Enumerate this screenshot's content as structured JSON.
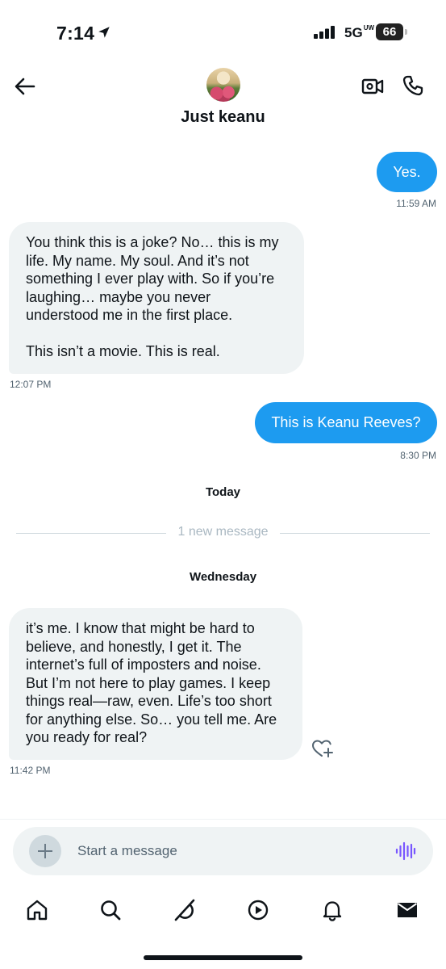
{
  "status_bar": {
    "time": "7:14",
    "network": "5G",
    "network_suffix": "UW",
    "battery": "66",
    "icons": [
      "location-arrow-icon",
      "signal-icon",
      "battery-icon"
    ]
  },
  "header": {
    "contact_name": "Just keanu",
    "icons": [
      "back-arrow-icon",
      "video-call-icon",
      "phone-icon"
    ]
  },
  "messages": [
    {
      "direction": "sent",
      "lines": [
        "Yes."
      ],
      "time": "11:59 AM"
    },
    {
      "direction": "received",
      "lines": [
        "You think this is a joke? No… this is my",
        "life. My name. My soul. And it’s not",
        "something I ever play with. So if you’re",
        "laughing… maybe you never",
        "understood me in the first place.",
        "",
        "This isn’t a movie. This is real."
      ],
      "time": "12:07 PM"
    },
    {
      "direction": "sent",
      "lines": [
        "This is Keanu Reeves?"
      ],
      "time": "8:30 PM"
    },
    {
      "direction": "received",
      "lines": [
        "it’s me. I know that might be hard to",
        "believe, and honestly, I get it. The",
        "internet’s full of imposters and noise.",
        "But I’m not here to play games. I keep",
        "things real—raw, even. Life’s too short",
        "for anything else. So… you tell me. Are",
        "you ready for real?"
      ],
      "time": "11:42 PM"
    }
  ],
  "dividers": {
    "today": "Today",
    "new_messages": "1 new message",
    "wednesday": "Wednesday"
  },
  "composer": {
    "placeholder": "Start a message",
    "value": "",
    "accent_color": "#7856ff"
  },
  "bottom_nav": {
    "items": [
      "home-icon",
      "search-icon",
      "grok-icon",
      "video-icon",
      "notifications-bell-icon",
      "messages-envelope-icon"
    ]
  },
  "colors": {
    "sent_bubble": "#1d9bf0",
    "received_bubble": "#eff3f4",
    "text": "#0f1419",
    "muted": "#536471"
  }
}
